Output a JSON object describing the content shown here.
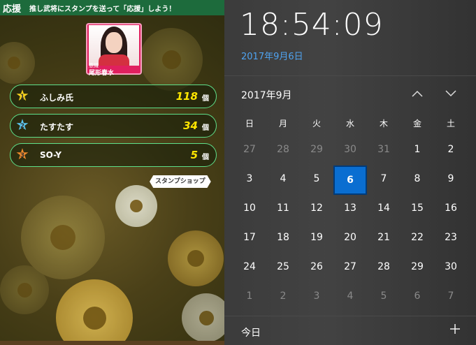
{
  "game": {
    "header_title": "応援",
    "header_subtitle": "推し武将にスタンプを送って「応援」しよう！",
    "avatar_label": "意識",
    "avatar_name": "尾形春水",
    "rankings": [
      {
        "rank": "1",
        "name": "ふしみ氏",
        "count": "118",
        "unit": "個",
        "star_color": "#f7d21e"
      },
      {
        "rank": "2",
        "name": "たすたす",
        "count": "34",
        "unit": "個",
        "star_color": "#5cc7f0"
      },
      {
        "rank": "3",
        "name": "SO-Y",
        "count": "5",
        "unit": "個",
        "star_color": "#f08a2c"
      }
    ],
    "stamp_shop_label": "スタンプショップ"
  },
  "flyout": {
    "time": "18:54:09",
    "date": "2017年9月6日",
    "month_title": "2017年9月",
    "prev_icon": "chevron-up-icon",
    "next_icon": "chevron-down-icon",
    "weekdays": [
      "日",
      "月",
      "火",
      "水",
      "木",
      "金",
      "土"
    ],
    "weeks": [
      [
        {
          "d": "27",
          "dim": true
        },
        {
          "d": "28",
          "dim": true
        },
        {
          "d": "29",
          "dim": true
        },
        {
          "d": "30",
          "dim": true
        },
        {
          "d": "31",
          "dim": true
        },
        {
          "d": "1"
        },
        {
          "d": "2"
        }
      ],
      [
        {
          "d": "3"
        },
        {
          "d": "4"
        },
        {
          "d": "5"
        },
        {
          "d": "6",
          "today": true
        },
        {
          "d": "7"
        },
        {
          "d": "8"
        },
        {
          "d": "9"
        }
      ],
      [
        {
          "d": "10"
        },
        {
          "d": "11"
        },
        {
          "d": "12"
        },
        {
          "d": "13"
        },
        {
          "d": "14"
        },
        {
          "d": "15"
        },
        {
          "d": "16"
        }
      ],
      [
        {
          "d": "17"
        },
        {
          "d": "18"
        },
        {
          "d": "19"
        },
        {
          "d": "20"
        },
        {
          "d": "21"
        },
        {
          "d": "22"
        },
        {
          "d": "23"
        }
      ],
      [
        {
          "d": "24"
        },
        {
          "d": "25"
        },
        {
          "d": "26"
        },
        {
          "d": "27"
        },
        {
          "d": "28"
        },
        {
          "d": "29"
        },
        {
          "d": "30"
        }
      ],
      [
        {
          "d": "1",
          "dim": true
        },
        {
          "d": "2",
          "dim": true
        },
        {
          "d": "3",
          "dim": true
        },
        {
          "d": "4",
          "dim": true
        },
        {
          "d": "5",
          "dim": true
        },
        {
          "d": "6",
          "dim": true
        },
        {
          "d": "7",
          "dim": true
        }
      ]
    ],
    "today_label": "今日",
    "add_icon": "plus-icon",
    "accent_color": "#0a6ed1",
    "link_color": "#4fa3f0"
  }
}
